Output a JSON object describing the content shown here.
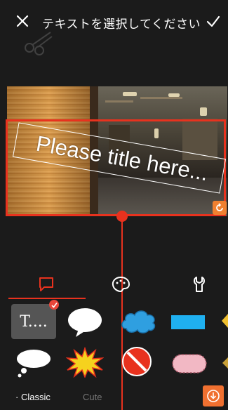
{
  "header": {
    "close_icon": "close-icon",
    "title": "テキストを選択してください",
    "confirm_icon": "check-icon"
  },
  "canvas": {
    "title_text": "Please title here..."
  },
  "tabs": [
    {
      "name": "speech-bubble-icon",
      "active": true
    },
    {
      "name": "palette-icon",
      "active": false
    },
    {
      "name": "wrench-icon",
      "active": false
    }
  ],
  "stickers": {
    "text_sticker_label": "T...."
  },
  "categories": {
    "classic": "Classic",
    "cute": "Cute"
  },
  "colors": {
    "accent": "#e8321e",
    "orange": "#f07030",
    "background": "#1b1b1b"
  }
}
